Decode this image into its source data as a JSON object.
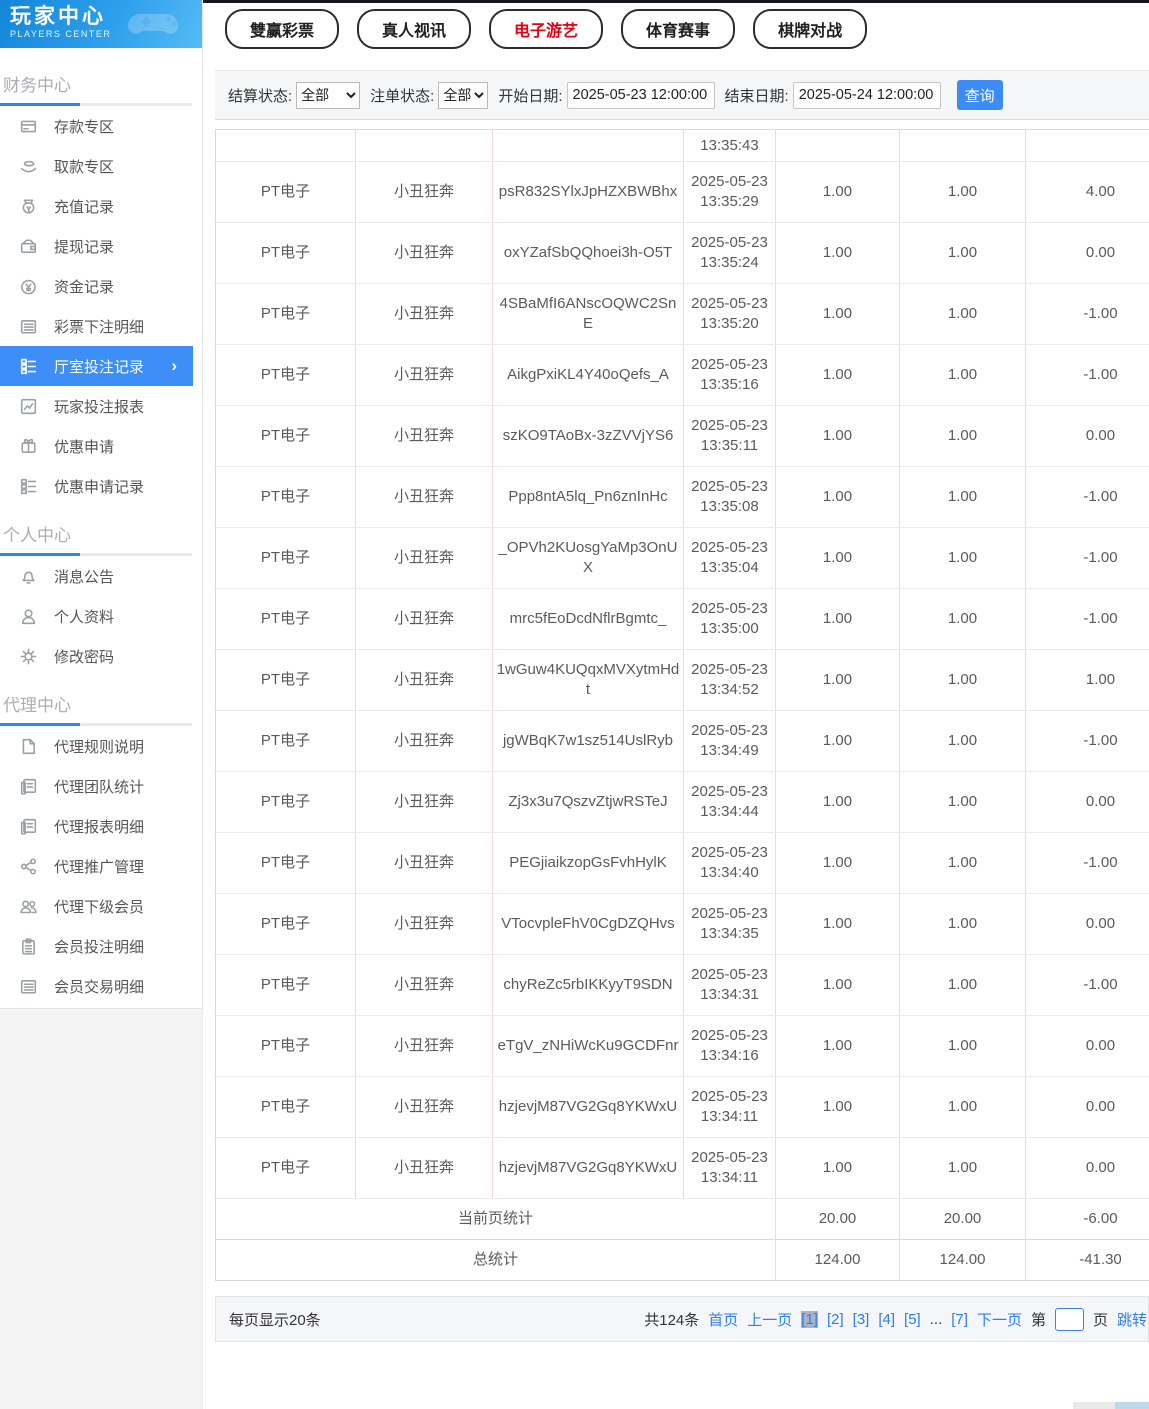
{
  "logo": {
    "title": "玩家中心",
    "subtitle": "PLAYERS CENTER"
  },
  "tabs": [
    {
      "id": "lottery",
      "label": "雙赢彩票",
      "active": false
    },
    {
      "id": "live-video",
      "label": "真人视讯",
      "active": false
    },
    {
      "id": "electronic-games",
      "label": "电子游艺",
      "active": true
    },
    {
      "id": "sports",
      "label": "体育赛事",
      "active": false
    },
    {
      "id": "board-games",
      "label": "棋牌对战",
      "active": false
    }
  ],
  "filters": {
    "settle_label": "结算状态:",
    "settle_value": "全部",
    "order_label": "注单状态:",
    "order_value": "全部",
    "start_label": "开始日期:",
    "start_value": "2025-05-23 12:00:00",
    "end_label": "结束日期:",
    "end_value": "2025-05-24 12:00:00",
    "query_label": "查询"
  },
  "sidebar": {
    "sections": [
      {
        "title": "财务中心",
        "items": [
          {
            "id": "deposit-zone",
            "label": "存款专区",
            "icon": "deposit-card-icon",
            "active": false
          },
          {
            "id": "withdraw-zone",
            "label": "取款专区",
            "icon": "hand-money-icon",
            "active": false
          },
          {
            "id": "recharge-records",
            "label": "充值记录",
            "icon": "money-bag-icon",
            "active": false
          },
          {
            "id": "withdraw-records",
            "label": "提现记录",
            "icon": "wallet-icon",
            "active": false
          },
          {
            "id": "funds-records",
            "label": "资金记录",
            "icon": "coin-icon",
            "active": false
          },
          {
            "id": "lottery-bet-details",
            "label": "彩票下注明细",
            "icon": "list-icon",
            "active": false
          },
          {
            "id": "hall-bet-records",
            "label": "厅室投注记录",
            "icon": "checklist-icon",
            "active": true
          },
          {
            "id": "player-bet-report",
            "label": "玩家投注报表",
            "icon": "chart-icon",
            "active": false
          },
          {
            "id": "promo-apply",
            "label": "优惠申请",
            "icon": "gift-icon",
            "active": false
          },
          {
            "id": "promo-apply-records",
            "label": "优惠申请记录",
            "icon": "checklist-icon",
            "active": false
          }
        ]
      },
      {
        "title": "个人中心",
        "items": [
          {
            "id": "messages",
            "label": "消息公告",
            "icon": "bell-icon",
            "active": false
          },
          {
            "id": "profile",
            "label": "个人资料",
            "icon": "person-icon",
            "active": false
          },
          {
            "id": "change-password",
            "label": "修改密码",
            "icon": "gear-icon",
            "active": false
          }
        ]
      },
      {
        "title": "代理中心",
        "items": [
          {
            "id": "agent-rules",
            "label": "代理规则说明",
            "icon": "document-icon",
            "active": false
          },
          {
            "id": "agent-team-stats",
            "label": "代理团队统计",
            "icon": "report-icon",
            "active": false
          },
          {
            "id": "agent-report-details",
            "label": "代理报表明细",
            "icon": "report-icon",
            "active": false
          },
          {
            "id": "agent-promotion",
            "label": "代理推广管理",
            "icon": "share-icon",
            "active": false
          },
          {
            "id": "agent-sub-members",
            "label": "代理下级会员",
            "icon": "people-icon",
            "active": false
          },
          {
            "id": "member-bet-details",
            "label": "会员投注明细",
            "icon": "clipboard-icon",
            "active": false
          },
          {
            "id": "member-transaction-details",
            "label": "会员交易明细",
            "icon": "list-icon",
            "active": false
          }
        ]
      }
    ]
  },
  "table": {
    "partial_row_time": "13:35:43",
    "rows": [
      {
        "platform": "PT电子",
        "game": "小丑狂奔",
        "order_id": "psR832SYlxJpHZXBWBhx",
        "time": "2025-05-23 13:35:29",
        "bet": "1.00",
        "valid": "1.00",
        "result": "4.00"
      },
      {
        "platform": "PT电子",
        "game": "小丑狂奔",
        "order_id": "oxYZafSbQQhoei3h-O5T",
        "time": "2025-05-23 13:35:24",
        "bet": "1.00",
        "valid": "1.00",
        "result": "0.00"
      },
      {
        "platform": "PT电子",
        "game": "小丑狂奔",
        "order_id": "4SBaMfI6ANscOQWC2SnE",
        "time": "2025-05-23 13:35:20",
        "bet": "1.00",
        "valid": "1.00",
        "result": "-1.00"
      },
      {
        "platform": "PT电子",
        "game": "小丑狂奔",
        "order_id": "AikgPxiKL4Y40oQefs_A",
        "time": "2025-05-23 13:35:16",
        "bet": "1.00",
        "valid": "1.00",
        "result": "-1.00"
      },
      {
        "platform": "PT电子",
        "game": "小丑狂奔",
        "order_id": "szKO9TAoBx-3zZVVjYS6",
        "time": "2025-05-23 13:35:11",
        "bet": "1.00",
        "valid": "1.00",
        "result": "0.00"
      },
      {
        "platform": "PT电子",
        "game": "小丑狂奔",
        "order_id": "Ppp8ntA5lq_Pn6znInHc",
        "time": "2025-05-23 13:35:08",
        "bet": "1.00",
        "valid": "1.00",
        "result": "-1.00"
      },
      {
        "platform": "PT电子",
        "game": "小丑狂奔",
        "order_id": "_OPVh2KUosgYaMp3OnUX",
        "time": "2025-05-23 13:35:04",
        "bet": "1.00",
        "valid": "1.00",
        "result": "-1.00"
      },
      {
        "platform": "PT电子",
        "game": "小丑狂奔",
        "order_id": "mrc5fEoDcdNflrBgmtc_",
        "time": "2025-05-23 13:35:00",
        "bet": "1.00",
        "valid": "1.00",
        "result": "-1.00"
      },
      {
        "platform": "PT电子",
        "game": "小丑狂奔",
        "order_id": "1wGuw4KUQqxMVXytmHdt",
        "time": "2025-05-23 13:34:52",
        "bet": "1.00",
        "valid": "1.00",
        "result": "1.00"
      },
      {
        "platform": "PT电子",
        "game": "小丑狂奔",
        "order_id": "jgWBqK7w1sz514UslRyb",
        "time": "2025-05-23 13:34:49",
        "bet": "1.00",
        "valid": "1.00",
        "result": "-1.00"
      },
      {
        "platform": "PT电子",
        "game": "小丑狂奔",
        "order_id": "Zj3x3u7QszvZtjwRSTeJ",
        "time": "2025-05-23 13:34:44",
        "bet": "1.00",
        "valid": "1.00",
        "result": "0.00"
      },
      {
        "platform": "PT电子",
        "game": "小丑狂奔",
        "order_id": "PEGjiaikzopGsFvhHylK",
        "time": "2025-05-23 13:34:40",
        "bet": "1.00",
        "valid": "1.00",
        "result": "-1.00"
      },
      {
        "platform": "PT电子",
        "game": "小丑狂奔",
        "order_id": "VTocvpleFhV0CgDZQHvs",
        "time": "2025-05-23 13:34:35",
        "bet": "1.00",
        "valid": "1.00",
        "result": "0.00"
      },
      {
        "platform": "PT电子",
        "game": "小丑狂奔",
        "order_id": "chyReZc5rbIKKyyT9SDN",
        "time": "2025-05-23 13:34:31",
        "bet": "1.00",
        "valid": "1.00",
        "result": "-1.00"
      },
      {
        "platform": "PT电子",
        "game": "小丑狂奔",
        "order_id": "eTgV_zNHiWcKu9GCDFnr",
        "time": "2025-05-23 13:34:16",
        "bet": "1.00",
        "valid": "1.00",
        "result": "0.00"
      },
      {
        "platform": "PT电子",
        "game": "小丑狂奔",
        "order_id": "hzjevjM87VG2Gq8YKWxU",
        "time": "2025-05-23 13:34:11",
        "bet": "1.00",
        "valid": "1.00",
        "result": "0.00"
      },
      {
        "platform": "PT电子",
        "game": "小丑狂奔",
        "order_id": "hzjevjM87VG2Gq8YKWxU",
        "time": "2025-05-23 13:34:11",
        "bet": "1.00",
        "valid": "1.00",
        "result": "0.00"
      }
    ],
    "page_summary": {
      "label": "当前页统计",
      "bet": "20.00",
      "valid": "20.00",
      "result": "-6.00"
    },
    "total_summary": {
      "label": "总统计",
      "bet": "124.00",
      "valid": "124.00",
      "result": "-41.30"
    }
  },
  "pagination": {
    "per_page": "每页显示20条",
    "total": "共124条",
    "first": "首页",
    "prev": "上一页",
    "pages": [
      "[1]",
      "[2]",
      "[3]",
      "[4]",
      "[5]"
    ],
    "current_page": "[1]",
    "ellipsis": "...",
    "last_page": "[7]",
    "next": "下一页",
    "jump_prefix": "第",
    "jump_suffix": "页",
    "jump_label": "跳转"
  },
  "colors": {
    "accent_blue": "#3d8ef7",
    "active_tab_red": "#e60012",
    "link_blue": "#2a7ff2",
    "table_divider_pink": "#f2d7d7",
    "current_page_bg": "#a9b3c3"
  }
}
